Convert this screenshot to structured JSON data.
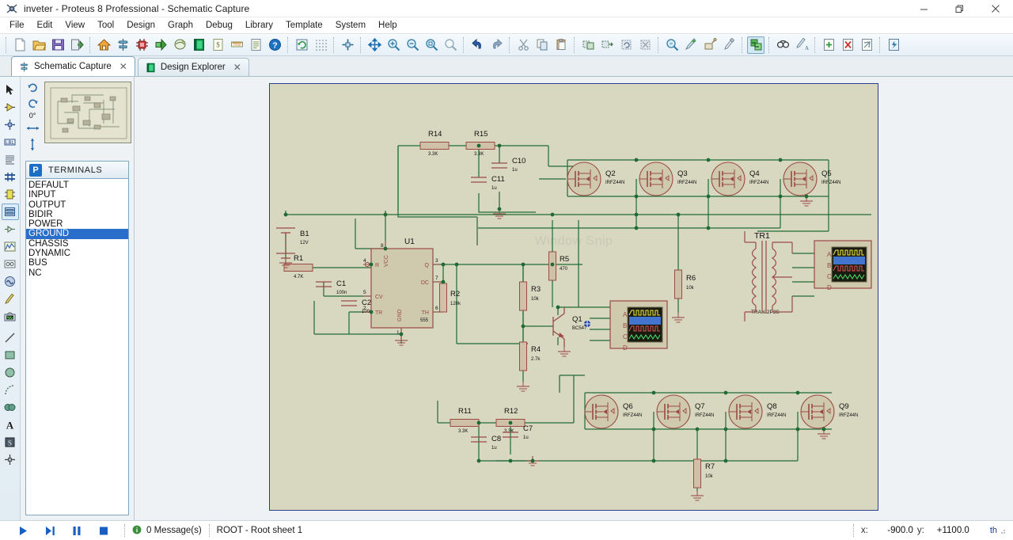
{
  "window": {
    "title": "inveter - Proteus 8 Professional - Schematic Capture",
    "app_icon": "proteus-icon",
    "minimize_label": "–",
    "restore_label": "❐",
    "close_label": "✕"
  },
  "menubar": {
    "items": [
      {
        "label": "File"
      },
      {
        "label": "Edit"
      },
      {
        "label": "View"
      },
      {
        "label": "Tool"
      },
      {
        "label": "Design"
      },
      {
        "label": "Graph"
      },
      {
        "label": "Debug"
      },
      {
        "label": "Library"
      },
      {
        "label": "Template"
      },
      {
        "label": "System"
      },
      {
        "label": "Help"
      }
    ]
  },
  "toolbar": {
    "groups": [
      {
        "buttons": [
          {
            "name": "new-project-icon",
            "title": "New Project"
          },
          {
            "name": "open-project-icon",
            "title": "Open Project"
          },
          {
            "name": "save-project-icon",
            "title": "Save Project"
          },
          {
            "name": "import-export-icon",
            "title": "Import/Export"
          }
        ]
      },
      {
        "buttons": [
          {
            "name": "home-icon",
            "title": "Home Page"
          },
          {
            "name": "schematic-capture-icon",
            "title": "Schematic Capture"
          },
          {
            "name": "pcb-layout-icon",
            "title": "PCB Layout"
          },
          {
            "name": "3d-visualizer-icon",
            "title": "3D Visualizer"
          },
          {
            "name": "source-code-icon",
            "title": "Source Code"
          },
          {
            "name": "design-explorer-icon",
            "title": "Design Explorer"
          },
          {
            "name": "bill-of-materials-icon",
            "title": "Bill of Materials"
          },
          {
            "name": "report-icon",
            "title": "Report"
          },
          {
            "name": "document-icon",
            "title": "Documentation"
          },
          {
            "name": "help-icon",
            "title": "Help"
          }
        ]
      },
      {
        "buttons": [
          {
            "name": "refresh-icon",
            "title": "Redraw"
          },
          {
            "name": "toggle-grid-icon",
            "title": "Toggle Grid"
          },
          {
            "name": "origin-icon",
            "title": "Toggle Origin"
          },
          {
            "name": "pan-icon",
            "title": "Pan"
          },
          {
            "name": "zoom-in-icon",
            "title": "Zoom In"
          },
          {
            "name": "zoom-out-icon",
            "title": "Zoom Out"
          },
          {
            "name": "zoom-area-icon",
            "title": "Zoom To Area"
          },
          {
            "name": "zoom-sheet-icon",
            "title": "Zoom To Sheet"
          }
        ]
      },
      {
        "buttons": [
          {
            "name": "undo-icon",
            "title": "Undo"
          },
          {
            "name": "redo-icon",
            "title": "Redo"
          }
        ]
      },
      {
        "buttons": [
          {
            "name": "cut-icon",
            "title": "Cut"
          },
          {
            "name": "copy-icon",
            "title": "Copy"
          },
          {
            "name": "paste-icon",
            "title": "Paste"
          }
        ]
      },
      {
        "buttons": [
          {
            "name": "block-copy-icon",
            "title": "Block Copy"
          },
          {
            "name": "block-move-icon",
            "title": "Block Move"
          },
          {
            "name": "block-rotate-icon",
            "title": "Block Rotate"
          },
          {
            "name": "block-delete-icon",
            "title": "Block Delete"
          }
        ]
      },
      {
        "buttons": [
          {
            "name": "pick-device-icon",
            "title": "Pick Device"
          },
          {
            "name": "make-device-icon",
            "title": "Make Device"
          },
          {
            "name": "packaging-tool-icon",
            "title": "Packaging Tool"
          },
          {
            "name": "decompose-icon",
            "title": "Decompose"
          }
        ]
      },
      {
        "buttons": [
          {
            "name": "wire-autorouter-icon",
            "title": "Wire Auto-Router",
            "active": true
          }
        ]
      },
      {
        "buttons": [
          {
            "name": "search-tag-icon",
            "title": "Search and Tag"
          },
          {
            "name": "property-assignment-icon",
            "title": "Property Assignment Tool"
          }
        ]
      },
      {
        "buttons": [
          {
            "name": "new-sheet-icon",
            "title": "New Sheet"
          },
          {
            "name": "remove-sheet-icon",
            "title": "Remove Sheet"
          },
          {
            "name": "exit-sheet-icon",
            "title": "Exit Sheet"
          }
        ]
      },
      {
        "buttons": [
          {
            "name": "netlist-icon",
            "title": "Generate Netlist"
          }
        ]
      }
    ]
  },
  "tabs": [
    {
      "label": "Schematic Capture",
      "icon": "schematic-capture-icon",
      "selected": true,
      "close": "✕"
    },
    {
      "label": "Design Explorer",
      "icon": "design-explorer-icon",
      "selected": false,
      "close": "✕"
    }
  ],
  "rail": {
    "items": [
      {
        "name": "selection-mode-icon",
        "title": "Selection Mode",
        "glyph": "arrow"
      },
      {
        "name": "component-mode-icon",
        "title": "Component Mode",
        "glyph": "component"
      },
      {
        "name": "junction-dot-icon",
        "title": "Junction Dot Mode",
        "glyph": "junction"
      },
      {
        "name": "wire-label-icon",
        "title": "Wire Label Mode",
        "glyph": "label"
      },
      {
        "name": "text-script-icon",
        "title": "Text Script Mode",
        "glyph": "script"
      },
      {
        "name": "buses-icon",
        "title": "Buses Mode",
        "glyph": "bus"
      },
      {
        "name": "subcircuit-icon",
        "title": "Subcircuit Mode",
        "glyph": "subckt"
      },
      {
        "name": "terminals-mode-icon",
        "title": "Terminals Mode",
        "glyph": "terminal",
        "active": true
      },
      {
        "name": "device-pins-icon",
        "title": "Device Pins Mode",
        "glyph": "pin"
      },
      {
        "name": "graph-mode-icon",
        "title": "Graph Mode",
        "glyph": "graph"
      },
      {
        "name": "tape-recorder-icon",
        "title": "Tape Recorder Mode",
        "glyph": "tape"
      },
      {
        "name": "generator-mode-icon",
        "title": "Generator Mode",
        "glyph": "generator"
      },
      {
        "name": "probe-mode-icon",
        "title": "Voltage Probe Mode",
        "glyph": "probe"
      },
      {
        "name": "virtual-instruments-icon",
        "title": "Virtual Instruments Mode",
        "glyph": "instrument"
      },
      {
        "name": "line-tool-icon",
        "title": "2D Graphics Line Mode",
        "glyph": "line"
      },
      {
        "name": "box-tool-icon",
        "title": "2D Graphics Box Mode",
        "glyph": "box"
      },
      {
        "name": "circle-tool-icon",
        "title": "2D Graphics Circle Mode",
        "glyph": "circle"
      },
      {
        "name": "arc-tool-icon",
        "title": "2D Graphics Arc Mode",
        "glyph": "arc"
      },
      {
        "name": "path-tool-icon",
        "title": "2D Graphics Path Mode",
        "glyph": "path"
      },
      {
        "name": "text-tool-icon",
        "title": "2D Graphics Text Mode",
        "glyph": "text"
      },
      {
        "name": "symbol-tool-icon",
        "title": "2D Graphics Symbols Mode",
        "glyph": "symbol"
      },
      {
        "name": "marker-tool-icon",
        "title": "2D Graphics Markers Mode",
        "glyph": "marker"
      }
    ]
  },
  "leftpanel": {
    "rotation_value": "0°",
    "rotate_cw_icon": "rotate-clockwise-icon",
    "rotate_ccw_icon": "rotate-counterclockwise-icon",
    "mirror_x_icon": "mirror-horizontal-icon",
    "mirror_y_icon": "mirror-vertical-icon",
    "terminals_title": "TERMINALS",
    "terminals_badge": "P",
    "terminals": [
      {
        "label": "DEFAULT",
        "selected": false
      },
      {
        "label": "INPUT",
        "selected": false
      },
      {
        "label": "OUTPUT",
        "selected": false
      },
      {
        "label": "BIDIR",
        "selected": false
      },
      {
        "label": "POWER",
        "selected": false
      },
      {
        "label": "GROUND",
        "selected": true
      },
      {
        "label": "CHASSIS",
        "selected": false
      },
      {
        "label": "DYNAMIC",
        "selected": false
      },
      {
        "label": "BUS",
        "selected": false
      },
      {
        "label": "NC",
        "selected": false
      }
    ]
  },
  "canvas": {
    "watermark": "Window Snip",
    "sheet_bg": "#d8d8c0",
    "wire_color": "#1f6b34",
    "body_color": "#c9c7a8",
    "outline_color": "#9b4a46",
    "text_color": "#111111",
    "components": [
      {
        "ref": "B1",
        "value": "12V",
        "type": "battery"
      },
      {
        "ref": "R1",
        "value": "4.7K",
        "type": "resistor"
      },
      {
        "ref": "C1",
        "value": "100n",
        "type": "capacitor"
      },
      {
        "ref": "C2",
        "value": "100n",
        "type": "capacitor"
      },
      {
        "ref": "U1",
        "value": "555",
        "type": "timer-ic"
      },
      {
        "ref": "R2",
        "value": "120k",
        "type": "resistor"
      },
      {
        "ref": "R3",
        "value": "10k",
        "type": "resistor"
      },
      {
        "ref": "R4",
        "value": "2.7k",
        "type": "resistor"
      },
      {
        "ref": "R5",
        "value": "470",
        "type": "resistor"
      },
      {
        "ref": "R6",
        "value": "10k",
        "type": "resistor"
      },
      {
        "ref": "R7",
        "value": "10k",
        "type": "resistor"
      },
      {
        "ref": "R11",
        "value": "3.3K",
        "type": "resistor"
      },
      {
        "ref": "R12",
        "value": "3.3K",
        "type": "resistor"
      },
      {
        "ref": "R14",
        "value": "3.3K",
        "type": "resistor"
      },
      {
        "ref": "R15",
        "value": "3.3K",
        "type": "resistor"
      },
      {
        "ref": "C7",
        "value": "1u",
        "type": "capacitor"
      },
      {
        "ref": "C8",
        "value": "1u",
        "type": "capacitor"
      },
      {
        "ref": "C10",
        "value": "1u",
        "type": "capacitor"
      },
      {
        "ref": "C11",
        "value": "1u",
        "type": "capacitor"
      },
      {
        "ref": "Q1",
        "value": "BC547",
        "type": "bjt"
      },
      {
        "ref": "Q2",
        "value": "IRFZ44N",
        "type": "mosfet"
      },
      {
        "ref": "Q3",
        "value": "IRFZ44N",
        "type": "mosfet"
      },
      {
        "ref": "Q4",
        "value": "IRFZ44N",
        "type": "mosfet"
      },
      {
        "ref": "Q5",
        "value": "IRFZ44N",
        "type": "mosfet"
      },
      {
        "ref": "Q6",
        "value": "IRFZ44N",
        "type": "mosfet"
      },
      {
        "ref": "Q7",
        "value": "IRFZ44N",
        "type": "mosfet"
      },
      {
        "ref": "Q8",
        "value": "IRFZ44N",
        "type": "mosfet"
      },
      {
        "ref": "Q9",
        "value": "IRFZ44N",
        "type": "mosfet"
      },
      {
        "ref": "TR1",
        "value": "TRAN-2P3S",
        "type": "transformer"
      }
    ],
    "ic_pins": {
      "left": [
        {
          "num": "4",
          "name": "R"
        },
        {
          "num": "5",
          "name": "CV"
        },
        {
          "num": "2",
          "name": "TR"
        }
      ],
      "right": [
        {
          "num": "3",
          "name": "Q"
        },
        {
          "num": "7",
          "name": "DC"
        },
        {
          "num": "6",
          "name": "TH"
        }
      ],
      "top": [
        {
          "num": "8",
          "name": "VCC"
        }
      ],
      "bottom": [
        {
          "num": "1",
          "name": "GND"
        }
      ]
    },
    "scope_channels": [
      "A",
      "B",
      "C",
      "D"
    ],
    "scope_trace_colors": [
      "#f4f442",
      "#4b86f0",
      "#e05555",
      "#49e06a"
    ]
  },
  "statusbar": {
    "play_icon": "play-icon",
    "step_icon": "step-icon",
    "pause_icon": "pause-icon",
    "stop_icon": "stop-icon",
    "messages": "0 Message(s)",
    "message_icon": "info-icon",
    "sheet": "ROOT - Root sheet 1",
    "x_label": "x:",
    "x_value": "-900.0",
    "y_label": "y:",
    "y_value": "+1100.0",
    "units": "th"
  }
}
